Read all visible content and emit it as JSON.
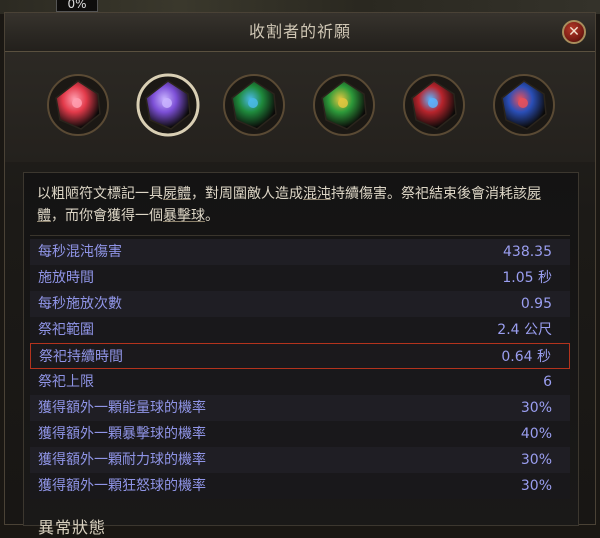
{
  "top_bar": {
    "progress_text": "0%"
  },
  "window": {
    "title": "收割者的祈願",
    "close_label": "✕"
  },
  "gems": [
    {
      "name": "red-gem-icon",
      "color": "#e23a4a",
      "accent": "#ff9fb0",
      "selected": false
    },
    {
      "name": "purple-gem-icon",
      "color": "#7c4fd6",
      "accent": "#c9b4ff",
      "selected": true
    },
    {
      "name": "green-blue-gem-icon",
      "color": "#1f8a3c",
      "accent": "#4ab8e6",
      "selected": false
    },
    {
      "name": "green-gold-gem-icon",
      "color": "#2d9a3a",
      "accent": "#e3c640",
      "selected": false
    },
    {
      "name": "red-blue-gem-icon",
      "color": "#b8242c",
      "accent": "#5ab4ff",
      "selected": false
    },
    {
      "name": "blue-red-gem-icon",
      "color": "#2a4fb8",
      "accent": "#e8505a",
      "selected": false
    }
  ],
  "description": {
    "p1": "以粗陋符文標記一具",
    "p2": "屍體",
    "p3": "，對周圍敵人造成",
    "p4": "混沌",
    "p5": "持續傷害。祭祀結束後會消耗該",
    "p6": "屍體",
    "p7": "，而你會獲得一個",
    "p8": "暴擊球",
    "p9": "。"
  },
  "stats": [
    {
      "label": "每秒混沌傷害",
      "value": "438.35"
    },
    {
      "label": "施放時間",
      "value": "1.05 秒"
    },
    {
      "label": "每秒施放次數",
      "value": "0.95"
    },
    {
      "label": "祭祀範圍",
      "value": "2.4 公尺"
    },
    {
      "label": "祭祀持續時間",
      "value": "0.64 秒"
    },
    {
      "label": "祭祀上限",
      "value": "6"
    },
    {
      "label": "獲得額外一顆能量球的機率",
      "value": "30%"
    },
    {
      "label": "獲得額外一顆暴擊球的機率",
      "value": "40%"
    },
    {
      "label": "獲得額外一顆耐力球的機率",
      "value": "30%"
    },
    {
      "label": "獲得額外一顆狂怒球的機率",
      "value": "30%"
    }
  ],
  "section": {
    "heading": "異常狀態"
  },
  "colors": {
    "stat_text": "#8f94e6",
    "highlight_border": "#b4331d",
    "description_text": "#ddd6c6"
  }
}
